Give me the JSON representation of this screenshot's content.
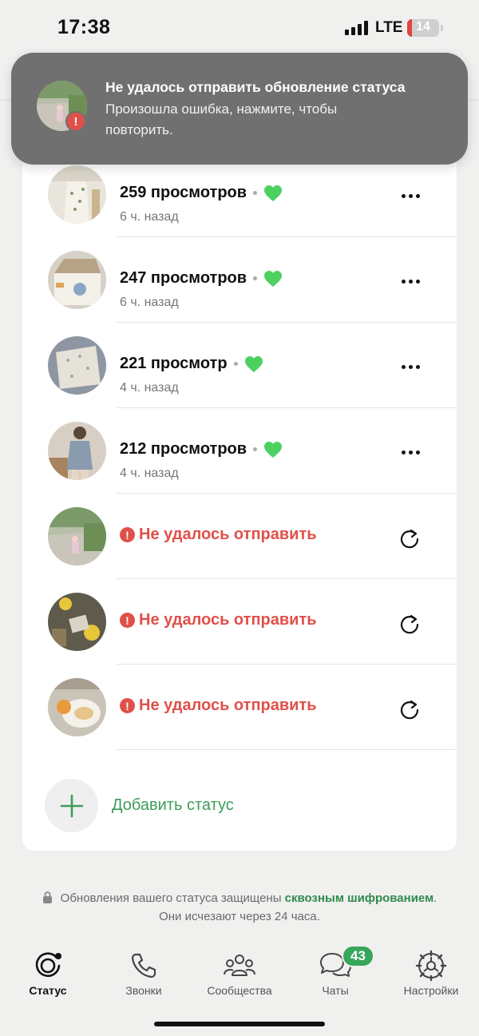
{
  "status_bar": {
    "time": "17:38",
    "network": "LTE",
    "battery": "14",
    "battery_level": 0.14
  },
  "toast": {
    "title": "Не удалось отправить обновление статуса",
    "body": "Произошла ошибка, нажмите, чтобы повторить.",
    "badge": "!"
  },
  "statuses": [
    {
      "views": "259 просмотров",
      "time_ago": "6 ч. назад"
    },
    {
      "views": "247 просмотров",
      "time_ago": "6 ч. назад"
    },
    {
      "views": "221 просмотр",
      "time_ago": "4 ч. назад"
    },
    {
      "views": "212 просмотров",
      "time_ago": "4 ч. назад"
    }
  ],
  "failed": [
    {
      "label": "Не удалось отправить"
    },
    {
      "label": "Не удалось отправить"
    },
    {
      "label": "Не удалось отправить"
    }
  ],
  "add_status": "Добавить статус",
  "note": {
    "text_before": "Обновления вашего статуса защищены ",
    "link": "сквозным шифрованием",
    "text_after": ".",
    "line2": "Они исчезают через 24 часа."
  },
  "tabs": {
    "status": "Статус",
    "calls": "Звонки",
    "communities": "Сообщества",
    "chats": "Чаты",
    "chats_badge": "43",
    "settings": "Настройки"
  },
  "colors": {
    "accent": "#36a65b",
    "error": "#e0504a",
    "heart": "#4cd160"
  }
}
